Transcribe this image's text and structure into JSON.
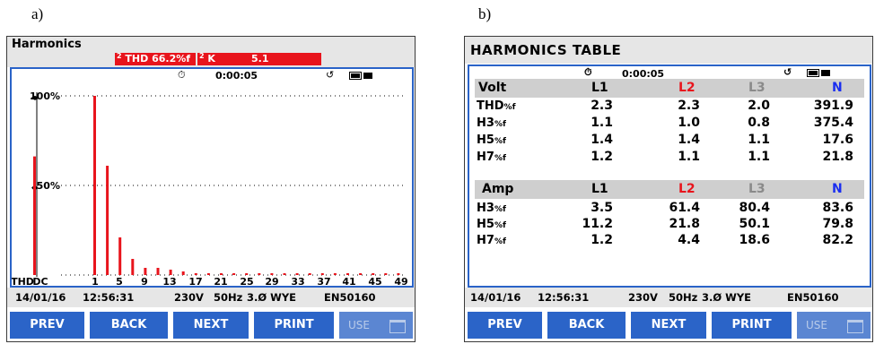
{
  "labels": {
    "a": "a)",
    "b": "b)"
  },
  "screen_a": {
    "title": "Harmonics",
    "thd_channel": "2",
    "thd_text": "THD 66.2%f",
    "k_channel": "2",
    "k_label": "K",
    "k_value": "5.1",
    "timer": "0:00:05",
    "y_labels": [
      "100%",
      "50%"
    ],
    "x_labels": [
      "THD",
      "DC",
      "1",
      "5",
      "9",
      "13",
      "17",
      "21",
      "25",
      "29",
      "33",
      "37",
      "41",
      "45",
      "49"
    ],
    "date": "14/01/16",
    "time": "12:56:31",
    "voltage": "230V",
    "freq": "50Hz",
    "phase": "3.Ø WYE",
    "standard": "EN50160",
    "buttons": {
      "prev": "PREV",
      "back": "BACK",
      "next": "NEXT",
      "print": "PRINT",
      "use": "USE"
    },
    "colors": {
      "bar": "#e8141c",
      "frame": "#2a63c8",
      "button": "#2b64c8"
    },
    "chart_data": {
      "type": "bar",
      "categories": [
        "THD",
        "DC",
        "1",
        "2",
        "3",
        "4",
        "5",
        "6",
        "7",
        "8",
        "9",
        "10",
        "11",
        "12",
        "13",
        "14",
        "15",
        "16",
        "17",
        "18",
        "19",
        "20",
        "21",
        "22",
        "23",
        "24",
        "25",
        "26",
        "27",
        "28",
        "29",
        "30",
        "31",
        "32",
        "33",
        "34",
        "35",
        "36",
        "37",
        "38",
        "39",
        "40",
        "41",
        "42",
        "43",
        "44",
        "45",
        "46",
        "47",
        "48",
        "49"
      ],
      "values": [
        66.2,
        0,
        100,
        0,
        61,
        0,
        21,
        0,
        9,
        0,
        4,
        0,
        4,
        0,
        3,
        0,
        2,
        0,
        1,
        0,
        1,
        0,
        1,
        0,
        1,
        0,
        1,
        0,
        1,
        0,
        1,
        0,
        1,
        0,
        1,
        0,
        1,
        0,
        1,
        0,
        1,
        0,
        1,
        0,
        1,
        0,
        1,
        0,
        1,
        0,
        1
      ],
      "ylim": [
        0,
        100
      ],
      "grid": true
    }
  },
  "screen_b": {
    "title": "HARMONICS TABLE",
    "timer": "0:00:05",
    "volt_header": {
      "label": "Volt",
      "cols": [
        "L1",
        "L2",
        "L3",
        "N"
      ]
    },
    "volt_rows": [
      {
        "label": "THD",
        "unit": "%f",
        "values": [
          "2.3",
          "2.3",
          "2.0",
          "391.9"
        ]
      },
      {
        "label": "H3",
        "unit": "%f",
        "values": [
          "1.1",
          "1.0",
          "0.8",
          "375.4"
        ]
      },
      {
        "label": "H5",
        "unit": "%f",
        "values": [
          "1.4",
          "1.4",
          "1.1",
          "17.6"
        ]
      },
      {
        "label": "H7",
        "unit": "%f",
        "values": [
          "1.2",
          "1.1",
          "1.1",
          "21.8"
        ]
      }
    ],
    "amp_header": {
      "label": "Amp",
      "cols": [
        "L1",
        "L2",
        "L3",
        "N"
      ]
    },
    "amp_rows": [
      {
        "label": "H3",
        "unit": "%f",
        "values": [
          "3.5",
          "61.4",
          "80.4",
          "83.6"
        ]
      },
      {
        "label": "H5",
        "unit": "%f",
        "values": [
          "11.2",
          "21.8",
          "50.1",
          "79.8"
        ]
      },
      {
        "label": "H7",
        "unit": "%f",
        "values": [
          "1.2",
          "4.4",
          "18.6",
          "82.2"
        ]
      }
    ],
    "date": "14/01/16",
    "time": "12:56:31",
    "voltage": "230V",
    "freq": "50Hz",
    "phase": "3.Ø WYE",
    "standard": "EN50160",
    "buttons": {
      "prev": "PREV",
      "back": "BACK",
      "next": "NEXT",
      "print": "PRINT",
      "use": "USE"
    },
    "colors": {
      "L1": "#000000",
      "L2": "#e8141c",
      "L3": "#8a8a8a",
      "N": "#1a2ef0"
    }
  }
}
